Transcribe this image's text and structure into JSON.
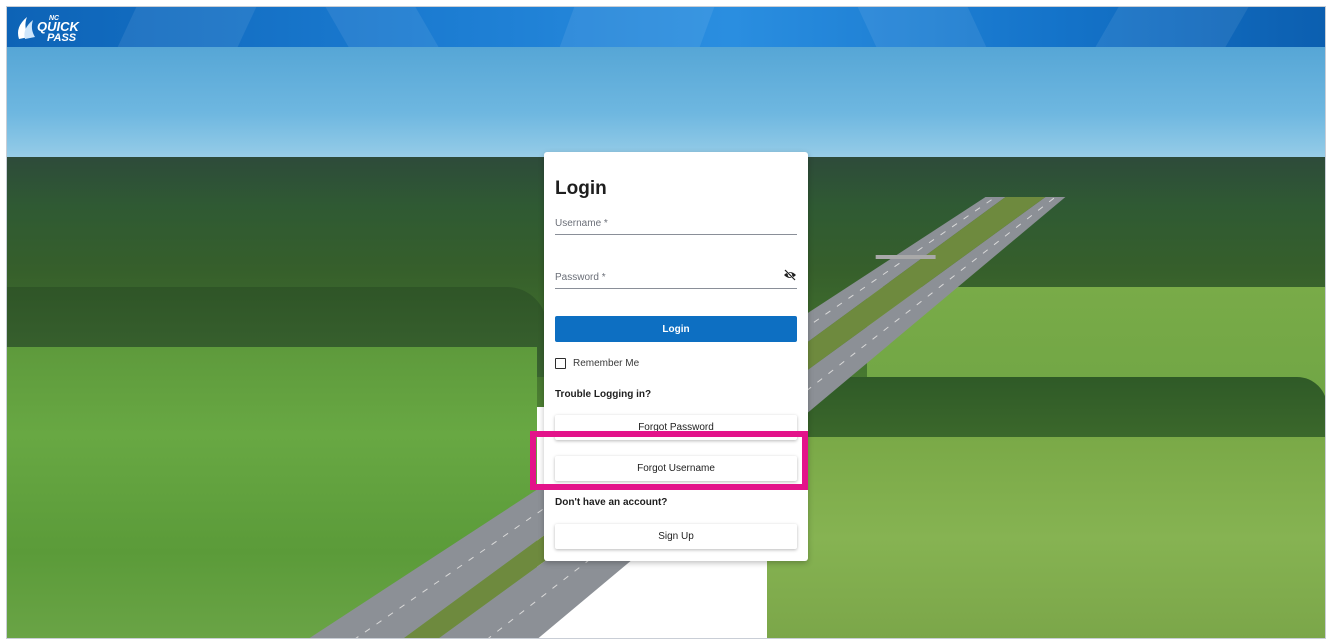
{
  "header": {
    "logo_text": "NC QUICK PASS",
    "brand_color": "#0d6fc2"
  },
  "login": {
    "title": "Login",
    "username_label": "Username",
    "password_label": "Password",
    "required_mark": "*",
    "login_button": "Login",
    "remember_me": "Remember Me",
    "trouble_heading": "Trouble Logging in?",
    "forgot_password": "Forgot Password",
    "forgot_username": "Forgot Username",
    "no_account_heading": "Don't have an account?",
    "sign_up": "Sign Up"
  },
  "icons": {
    "password_toggle": "eye-slash-icon"
  },
  "annotation": {
    "highlight_color": "#e3138a",
    "target": "Forgot Username"
  }
}
